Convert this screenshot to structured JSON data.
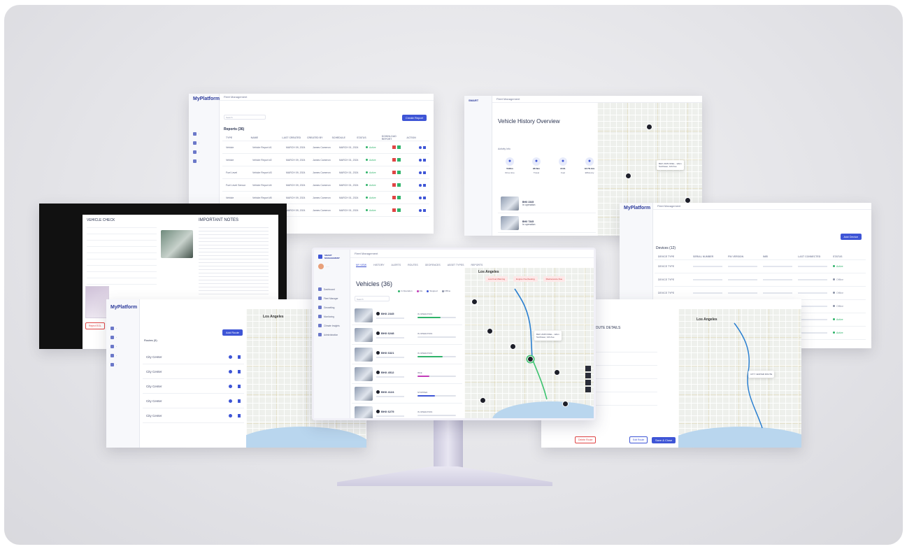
{
  "brand": "MyPlatform",
  "breadcrumb": "Fleet Management",
  "top_left": {
    "title": "Reports (36)",
    "search_placeholder": "Search",
    "create_button": "Create Report",
    "columns": [
      "TYPE",
      "NAME",
      "LAST CREATED",
      "CREATED BY",
      "SCHEDULE",
      "STATUS",
      "DOWNLOAD REPORT",
      "ACTION"
    ],
    "rows": [
      {
        "type": "Vehicle",
        "name": "Vehicle Report #1",
        "created": "MARCH 09, 2024",
        "by": "James Cameron",
        "schedule": "MARCH 01, 2024",
        "status": "Active"
      },
      {
        "type": "Vehicle",
        "name": "Vehicle Report #2",
        "created": "MARCH 09, 2024",
        "by": "James Cameron",
        "schedule": "MARCH 01, 2024",
        "status": "Active"
      },
      {
        "type": "Fuel Level",
        "name": "Vehicle Report #3",
        "created": "MARCH 09, 2024",
        "by": "James Cameron",
        "schedule": "MARCH 01, 2024",
        "status": "Active"
      },
      {
        "type": "Fuel Level Sensor",
        "name": "Vehicle Report #4",
        "created": "MARCH 09, 2024",
        "by": "James Cameron",
        "schedule": "MARCH 01, 2024",
        "status": "Active"
      },
      {
        "type": "Vehicle",
        "name": "Vehicle Report #5",
        "created": "MARCH 09, 2024",
        "by": "James Cameron",
        "schedule": "MARCH 01, 2024",
        "status": "Active"
      },
      {
        "type": "Vehicle",
        "name": "Vehicle Report #6",
        "created": "MARCH 09, 2024",
        "by": "James Cameron",
        "schedule": "MARCH 01, 2024",
        "status": "Active"
      }
    ]
  },
  "top_right": {
    "title": "Vehicle History Overview",
    "activity_label": "Activity Info",
    "kpis": [
      {
        "icon": "clock-icon",
        "value": "5h30m",
        "label": "Drive time"
      },
      {
        "icon": "route-icon",
        "value": "98.5km",
        "label": "Travel"
      },
      {
        "icon": "fuel-icon",
        "value": "22.8L",
        "label": "Fuel"
      },
      {
        "icon": "gauge-icon",
        "value": "18.75L/km",
        "label": "Efficiency"
      },
      {
        "icon": "alert-icon",
        "value": "3",
        "label": "Warnings"
      }
    ],
    "vehicles": [
      {
        "plate": "BHX 2345",
        "status": "In operation"
      },
      {
        "plate": "BHX 7345",
        "status": "In operation"
      }
    ],
    "map_popup": [
      "BHX 2345 NOEL - 12km",
      "Sunflower, 123 Ave"
    ]
  },
  "left_doc": {
    "title": "VEHICLE CHECK",
    "notes_title": "IMPORTANT NOTES",
    "reject_button": "Reject EOL"
  },
  "right_table": {
    "title": "Devices (12)",
    "add_button": "Add Device",
    "columns": [
      "DEVICE TYPE",
      "SERIAL NUMBER",
      "FW VERSION",
      "IMEI",
      "LAST CONNECTED",
      "STATUS"
    ],
    "rows": [
      {
        "type": "DEVICE TYPE",
        "status": "Active"
      },
      {
        "type": "DEVICE TYPE",
        "status": "Offline"
      },
      {
        "type": "DEVICE TYPE",
        "status": "Offline"
      },
      {
        "type": "DEVICE TYPE",
        "status": "Offline"
      },
      {
        "type": "DEVICE TYPE",
        "status": "Active"
      },
      {
        "type": "DEVICE TYPE",
        "status": "Active"
      }
    ]
  },
  "bottom_left": {
    "title": "Routes (5)",
    "add_button": "Add Route",
    "map_label": "Los Angeles",
    "routes": [
      "City Center",
      "City Center",
      "City Center",
      "City Center",
      "City Center"
    ]
  },
  "bottom_right": {
    "title": "ROUTE DETAILS",
    "map_label": "Los Angeles",
    "delete_button": "Delete Route",
    "edit_button": "Edit Route",
    "save_button": "Save & Close",
    "popup": "CITY CENTER ROUTE"
  },
  "monitor": {
    "title": "Vehicles (36)",
    "search_placeholder": "Search",
    "map_label": "Los Angeles",
    "tabs": [
      "MY VIEW",
      "HISTORY",
      "ALERTS",
      "ROUTES",
      "GEOFENCES",
      "ASSET TYPES",
      "REPORTS"
    ],
    "legend": [
      {
        "label": "In Operation",
        "color": "#2fb36a"
      },
      {
        "label": "Idle",
        "color": "#c23bb8"
      },
      {
        "label": "Stopped",
        "color": "#3e55d6"
      },
      {
        "label": "Offline",
        "color": "#8c93a8"
      }
    ],
    "nav": [
      "Dashboard",
      "Fleet Manager",
      "Geosetting",
      "Monitoring",
      "Climate Insights",
      "Administration"
    ],
    "alerts": [
      "Low Fuel Warning",
      "Engine Overheating",
      "Maintenance Due"
    ],
    "vehicles": [
      {
        "plate": "BHX 2345",
        "state": "IN OPERATION",
        "fill": 0.6,
        "color": "#2fb36a"
      },
      {
        "plate": "BHX 6248",
        "state": "IN OPERATION",
        "fill": 0.0,
        "color": "#2fb36a"
      },
      {
        "plate": "BHX 6321",
        "state": "IN OPERATION",
        "fill": 0.65,
        "color": "#2fb36a"
      },
      {
        "plate": "BHX 4512",
        "state": "IDLE",
        "fill": 0.3,
        "color": "#c23bb8"
      },
      {
        "plate": "BHX 4124",
        "state": "STOPPED",
        "fill": 0.45,
        "color": "#3e55d6"
      },
      {
        "plate": "BHX 6275",
        "state": "IN OPERATION",
        "fill": 0.0,
        "color": "#2fb36a"
      }
    ],
    "popup": [
      "BHX 2345 NOEL - 12km",
      "Sunflower, 123 Ave"
    ]
  }
}
